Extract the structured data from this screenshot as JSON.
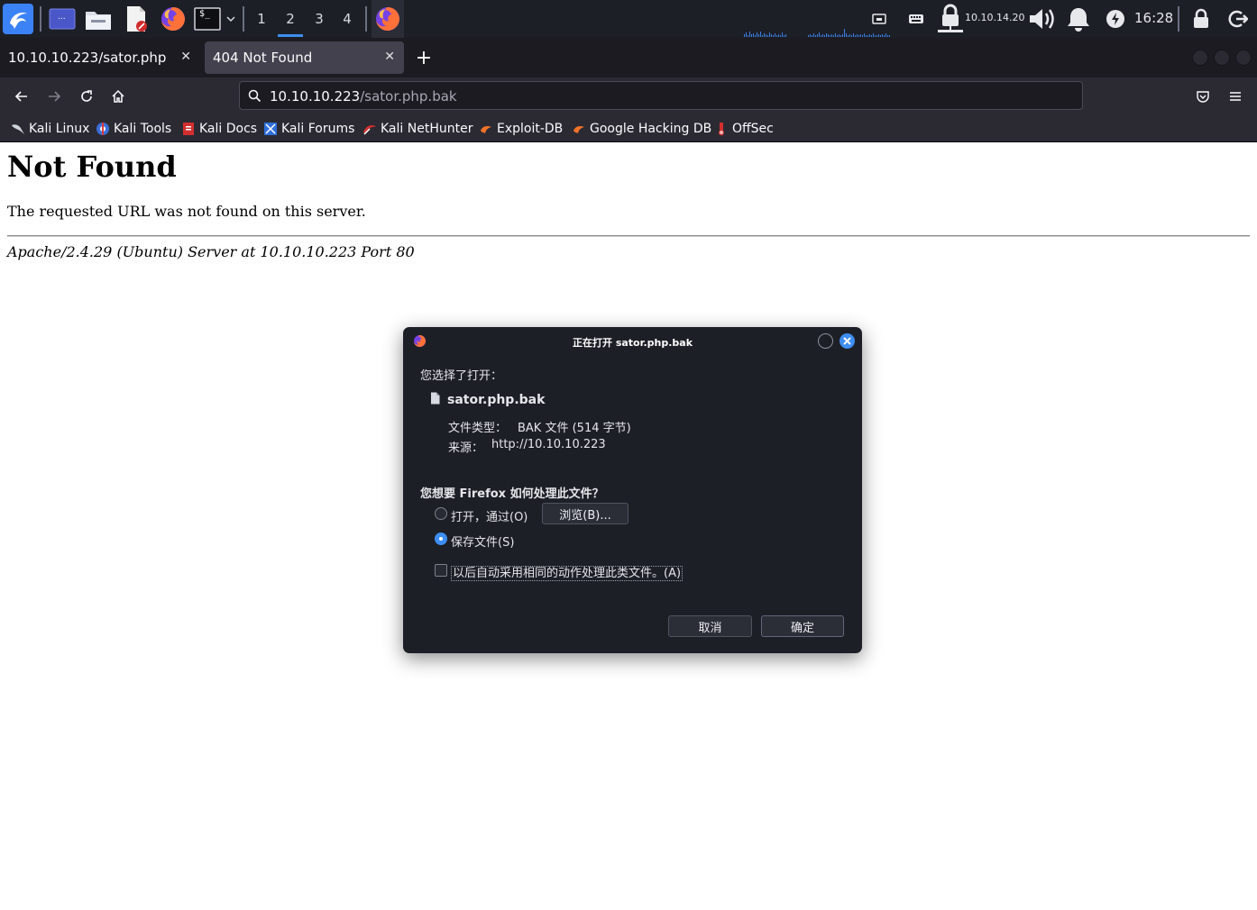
{
  "panel": {
    "workspaces": [
      "1",
      "2",
      "3",
      "4"
    ],
    "active_workspace": "2",
    "ip": "10.10.14.20",
    "clock": "16:28",
    "terminal_prompt": "$_",
    "files_label": "...",
    "icons": [
      "kali-menu-icon",
      "workspace-preview-icon",
      "file-manager-icon",
      "text-editor-icon",
      "firefox-icon",
      "terminal-icon",
      "chevron-down-icon",
      "firefox-running-icon",
      "network-icon",
      "keyboard-icon",
      "vpn-lock-icon",
      "volume-icon",
      "bell-icon",
      "power-icon",
      "lock-icon",
      "logout-icon"
    ]
  },
  "browser": {
    "tabs": [
      {
        "label": "10.10.10.223/sator.php",
        "active": false
      },
      {
        "label": "404 Not Found",
        "active": true
      }
    ],
    "url_host": "10.10.10.223",
    "url_path": "/sator.php.bak",
    "bookmarks": [
      {
        "label": "Kali Linux",
        "icon": "kali-dragon-icon"
      },
      {
        "label": "Kali Tools",
        "icon": "kali-tools-icon"
      },
      {
        "label": "Kali Docs",
        "icon": "kali-docs-icon"
      },
      {
        "label": "Kali Forums",
        "icon": "kali-forums-icon"
      },
      {
        "label": "Kali NetHunter",
        "icon": "nethunter-icon"
      },
      {
        "label": "Exploit-DB",
        "icon": "exploit-db-icon"
      },
      {
        "label": "Google Hacking DB",
        "icon": "ghdb-icon"
      },
      {
        "label": "OffSec",
        "icon": "offsec-icon"
      }
    ]
  },
  "page": {
    "title": "Not Found",
    "message": "The requested URL was not found on this server.",
    "address": "Apache/2.4.29 (Ubuntu) Server at 10.10.10.223 Port 80"
  },
  "dialog": {
    "title": "正在打开 sator.php.bak",
    "chosen_label": "您选择了打开：",
    "filename": "sator.php.bak",
    "type_label": "文件类型：",
    "type_value": "BAK 文件 (514 字节)",
    "source_label": "来源：",
    "source_value": "http://10.10.10.223",
    "question": "您想要 Firefox 如何处理此文件？",
    "open_with_label": "打开，通过(O)",
    "browse_button": "浏览(B)...",
    "save_label": "保存文件(S)",
    "selected_option": "save",
    "remember_label": "以后自动采用相同的动作处理此类文件。(A)",
    "remember_checked": false,
    "cancel_button": "取消",
    "ok_button": "确定"
  },
  "colors": {
    "panel_bg": "#1c1f26",
    "tabstrip_bg": "#1c1b22",
    "toolbar_bg": "#2b2a33",
    "dialog_bg": "#1d1f27",
    "accent": "#3d8ef0"
  }
}
